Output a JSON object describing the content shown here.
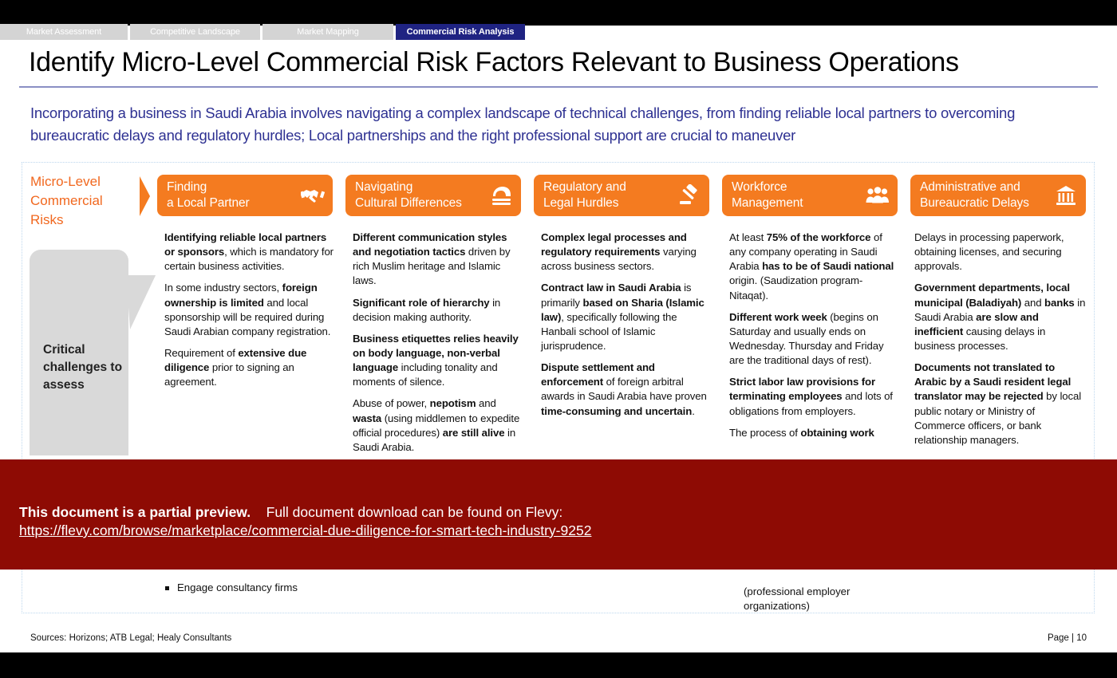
{
  "colors": {
    "orange": "#f47b20",
    "orange_text": "#f1681f",
    "navy": "#1f2382",
    "subtitle_blue": "#2e3192",
    "banner_red": "#8e0b04",
    "gray_box": "#d9d9d9"
  },
  "tabs": [
    {
      "label": "Market Assessment",
      "active": false
    },
    {
      "label": "Competitive Landscape",
      "active": false
    },
    {
      "label": "Market Mapping",
      "active": false
    },
    {
      "label": "Commercial Risk Analysis",
      "active": true
    }
  ],
  "header": {
    "title": "Identify Micro-Level Commercial Risk Factors Relevant to Business Operations",
    "subtitle": "Incorporating a business in Saudi Arabia involves navigating a complex landscape of technical challenges, from finding reliable local partners to overcoming bureaucratic delays and regulatory hurdles; Local partnerships and the right professional support are crucial to maneuver"
  },
  "left_panel": {
    "label": "Micro-Level Commercial Risks",
    "callout": "Critical challenges to assess"
  },
  "columns": [
    {
      "title_line1": "Finding",
      "title_line2": "a Local Partner",
      "icon": "handshake-icon",
      "paragraphs": [
        [
          {
            "t": "Identifying reliable local partners or sponsors",
            "b": true
          },
          {
            "t": ", which is mandatory for certain business activities.",
            "b": false
          }
        ],
        [
          {
            "t": "In some industry sectors, ",
            "b": false
          },
          {
            "t": "foreign ownership is limited",
            "b": true
          },
          {
            "t": " and local sponsorship will be required during Saudi Arabian company registration.",
            "b": false
          }
        ],
        [
          {
            "t": "Requirement of ",
            "b": false
          },
          {
            "t": "extensive due diligence",
            "b": true
          },
          {
            "t": " prior to signing an agreement.",
            "b": false
          }
        ]
      ]
    },
    {
      "title_line1": "Navigating",
      "title_line2": "Cultural Differences",
      "icon": "headscarf-icon",
      "paragraphs": [
        [
          {
            "t": "Different communication styles and negotiation tactics",
            "b": true
          },
          {
            "t": " driven by rich Muslim heritage and Islamic laws.",
            "b": false
          }
        ],
        [
          {
            "t": "Significant role of hierarchy",
            "b": true
          },
          {
            "t": " in decision making authority.",
            "b": false
          }
        ],
        [
          {
            "t": "Business etiquettes relies heavily on body language, non-verbal language",
            "b": true
          },
          {
            "t": " including tonality and moments of silence.",
            "b": false
          }
        ],
        [
          {
            "t": "Abuse of power, ",
            "b": false
          },
          {
            "t": "nepotism",
            "b": true
          },
          {
            "t": " and ",
            "b": false
          },
          {
            "t": "wasta",
            "b": true
          },
          {
            "t": " (using middlemen to expedite official procedures) ",
            "b": false
          },
          {
            "t": "are still alive",
            "b": true
          },
          {
            "t": " in Saudi Arabia.",
            "b": false
          }
        ]
      ]
    },
    {
      "title_line1": "Regulatory and",
      "title_line2": "Legal Hurdles",
      "icon": "gavel-icon",
      "paragraphs": [
        [
          {
            "t": "Complex legal processes and regulatory requirements",
            "b": true
          },
          {
            "t": " varying across business sectors.",
            "b": false
          }
        ],
        [
          {
            "t": "Contract law in Saudi Arabia",
            "b": true
          },
          {
            "t": " is primarily ",
            "b": false
          },
          {
            "t": "based on Sharia (Islamic law)",
            "b": true
          },
          {
            "t": ", specifically following the Hanbali school of Islamic jurisprudence.",
            "b": false
          }
        ],
        [
          {
            "t": "Dispute settlement and enforcement",
            "b": true
          },
          {
            "t": " of foreign arbitral awards in Saudi Arabia have proven ",
            "b": false
          },
          {
            "t": "time-consuming and uncertain",
            "b": true
          },
          {
            "t": ".",
            "b": false
          }
        ]
      ]
    },
    {
      "title_line1": "Workforce",
      "title_line2": "Management",
      "icon": "people-group-icon",
      "paragraphs": [
        [
          {
            "t": "At least ",
            "b": false
          },
          {
            "t": "75% of the workforce",
            "b": true
          },
          {
            "t": " of any company operating in Saudi Arabia ",
            "b": false
          },
          {
            "t": "has to be of Saudi national",
            "b": true
          },
          {
            "t": " origin. (Saudization program-Nitaqat).",
            "b": false
          }
        ],
        [
          {
            "t": "Different work week",
            "b": true
          },
          {
            "t": " (begins on Saturday and usually ends on Wednesday. Thursday and Friday are the traditional days of rest).",
            "b": false
          }
        ],
        [
          {
            "t": "Strict labor law provisions for terminating employees",
            "b": true
          },
          {
            "t": " and lots of obligations from employers.",
            "b": false
          }
        ],
        [
          {
            "t": "The process of ",
            "b": false
          },
          {
            "t": "obtaining work",
            "b": true
          }
        ]
      ]
    },
    {
      "title_line1": "Administrative and",
      "title_line2": "Bureaucratic Delays",
      "icon": "bank-icon",
      "paragraphs": [
        [
          {
            "t": "Delays in processing paperwork, obtaining licenses, and securing approvals.",
            "b": false
          }
        ],
        [
          {
            "t": "Government departments, local municipal (Baladiyah)",
            "b": true
          },
          {
            "t": " and ",
            "b": false
          },
          {
            "t": "banks",
            "b": true
          },
          {
            "t": " in Saudi Arabia ",
            "b": false
          },
          {
            "t": "are slow and inefficient",
            "b": true
          },
          {
            "t": " causing delays in business processes.",
            "b": false
          }
        ],
        [
          {
            "t": "Documents not translated to Arabic by a Saudi resident legal translator may be rejected",
            "b": true
          },
          {
            "t": " by local public notary or Ministry of Commerce officers, or bank relationship managers.",
            "b": false
          }
        ]
      ]
    }
  ],
  "lower": {
    "bullet": "Engage consultancy firms",
    "note": "(professional employer organizations)"
  },
  "banner": {
    "bold_text": "This document is a partial preview.",
    "rest_text": "Full document download can be found on Flevy:",
    "url": "https://flevy.com/browse/marketplace/commercial-due-diligence-for-smart-tech-industry-9252"
  },
  "footer": {
    "sources": "Sources: Horizons; ATB Legal; Healy Consultants",
    "page": "Page | 10"
  }
}
